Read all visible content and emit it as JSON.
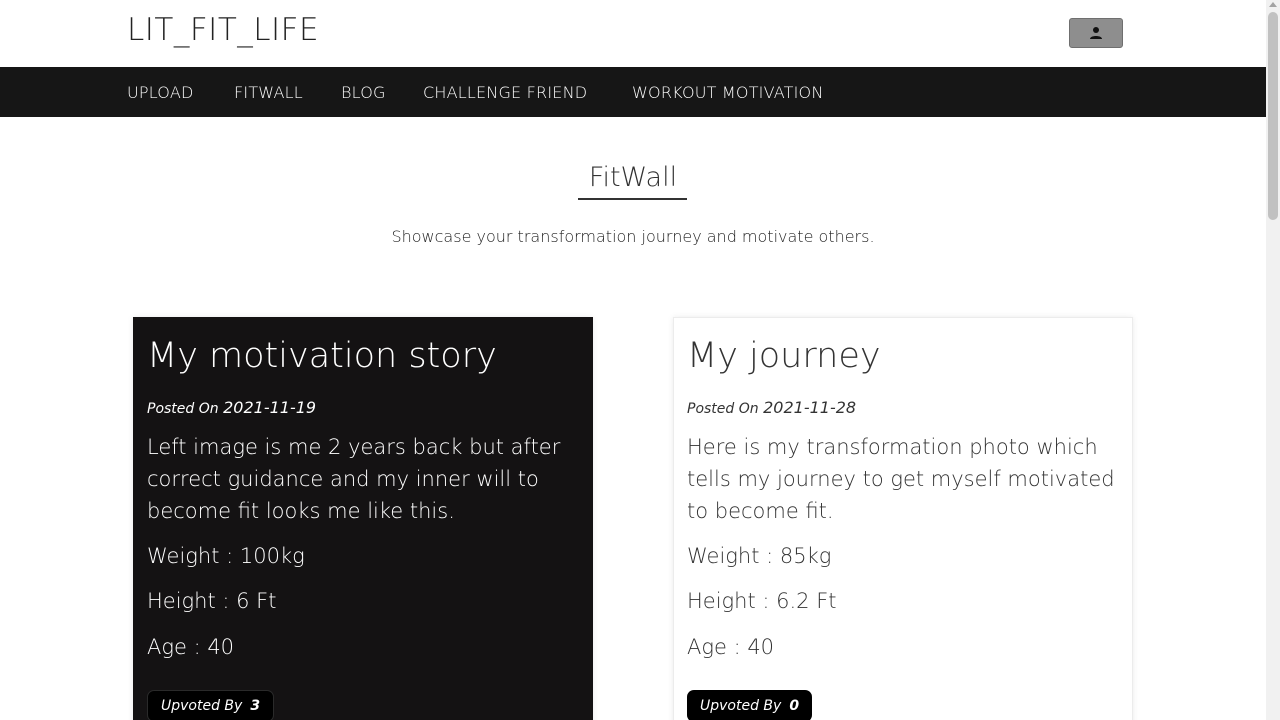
{
  "header": {
    "brand": "LIT_FIT_LIFE",
    "user_icon": "user-icon"
  },
  "nav": {
    "items": [
      {
        "label": "UPLOAD"
      },
      {
        "label": "FITWALL"
      },
      {
        "label": "BLOG"
      },
      {
        "label": "CHALLENGE FRIEND"
      },
      {
        "label": "WORKOUT MOTIVATION"
      }
    ]
  },
  "page": {
    "title": "FitWall",
    "subtitle": "Showcase your transformation journey and motivate others."
  },
  "posts": [
    {
      "title": "My motivation story",
      "posted_label": "Posted On",
      "date": "2021-11-19",
      "description": "Left image is me 2 years back but after correct guidance and my inner will to become fit looks me like this.",
      "weight": "Weight : 100kg",
      "height": "Height : 6 Ft",
      "age": "Age : 40",
      "upvote_label": "Upvoted By",
      "upvote_count": "3"
    },
    {
      "title": "My journey",
      "posted_label": "Posted On",
      "date": "2021-11-28",
      "description": "Here is my transformation photo which tells my journey to get myself motivated to become fit.",
      "weight": "Weight : 85kg",
      "height": "Height : 6.2 Ft",
      "age": "Age : 40",
      "upvote_label": "Upvoted By",
      "upvote_count": "0"
    }
  ],
  "colors": {
    "navbar": "#161616",
    "dark_card": "#141213",
    "user_button": "#8e8e8e"
  }
}
